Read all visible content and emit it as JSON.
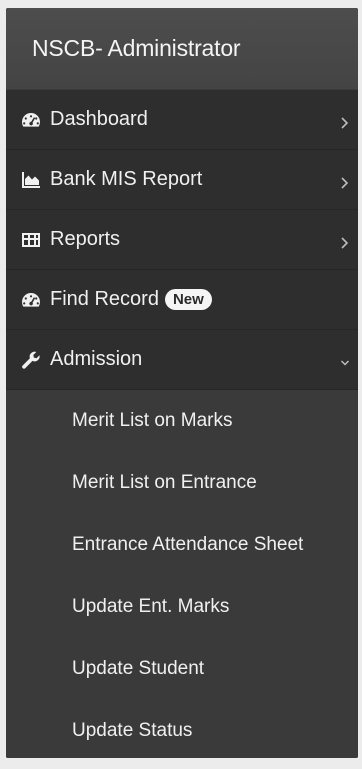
{
  "sidebar": {
    "title": "NSCB- Administrator",
    "items": [
      {
        "label": "Dashboard",
        "icon": "tachometer-icon",
        "has_chevron": true
      },
      {
        "label": "Bank MIS Report",
        "icon": "area-chart-icon",
        "has_chevron": true
      },
      {
        "label": "Reports",
        "icon": "table-icon",
        "has_chevron": true
      },
      {
        "label": "Find Record",
        "icon": "tachometer-icon",
        "badge": "New"
      },
      {
        "label": "Admission",
        "icon": "wrench-icon",
        "has_chevron": true,
        "expanded": true
      }
    ],
    "submenu": [
      {
        "label": "Merit List on Marks"
      },
      {
        "label": "Merit List on Entrance"
      },
      {
        "label": "Entrance Attendance Sheet"
      },
      {
        "label": "Update Ent. Marks"
      },
      {
        "label": "Update Student"
      },
      {
        "label": "Update Status"
      }
    ]
  },
  "colors": {
    "header_bg": "#4a4a4a",
    "menu_bg": "#2e2e2e",
    "submenu_bg": "#3a3a3a",
    "text": "#f0f0f0",
    "badge_bg": "#f5f5f5"
  }
}
